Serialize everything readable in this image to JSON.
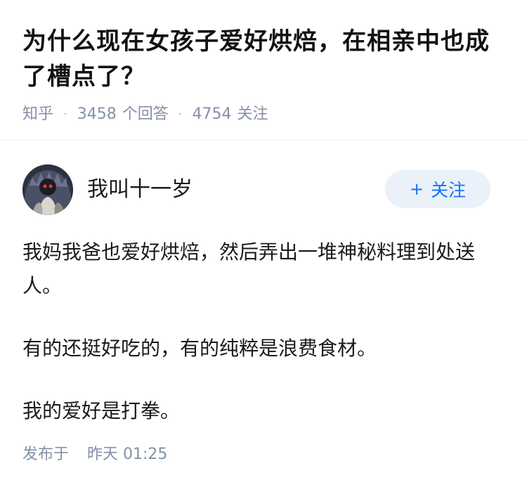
{
  "question": {
    "title": "为什么现在女孩子爱好烘焙，在相亲中也成了槽点了？",
    "source": "知乎",
    "answer_count": "3458",
    "answer_label": "个回答",
    "follow_count": "4754",
    "follow_label": "关注"
  },
  "answer": {
    "author_name": "我叫十一岁",
    "follow_button": "关注",
    "follow_icon": "plus-icon",
    "paragraphs": [
      "我妈我爸也爱好烘焙，然后弄出一堆神秘料理到处送人。",
      "有的还挺好吃的，有的纯粹是浪费食材。",
      "我的爱好是打拳。"
    ],
    "published_label": "发布于",
    "published_time": "昨天 01:25"
  },
  "colors": {
    "accent": "#1772f6",
    "button_bg": "#ebf1f8",
    "meta_text": "#8590a6"
  }
}
